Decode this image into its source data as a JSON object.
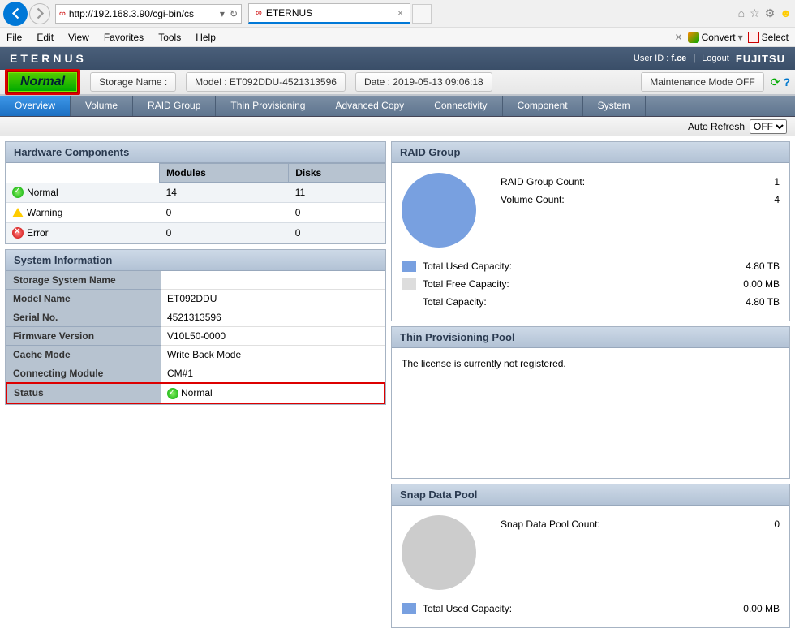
{
  "browser": {
    "url": "http://192.168.3.90/cgi-bin/cs",
    "tab_title": "ETERNUS",
    "menu": [
      "File",
      "Edit",
      "View",
      "Favorites",
      "Tools",
      "Help"
    ],
    "convert_label": "Convert",
    "select_label": "Select"
  },
  "header": {
    "brand": "ETERNUS",
    "user_label": "User ID :",
    "user_id": "f.ce",
    "logout": "Logout",
    "vendor": "FUJITSU"
  },
  "status_bar": {
    "status": "Normal",
    "storage_name_label": "Storage Name :",
    "model_label": "Model : ET092DDU-4521313596",
    "date_label": "Date : 2019-05-13 09:06:18",
    "maintenance": "Maintenance Mode OFF"
  },
  "nav": [
    "Overview",
    "Volume",
    "RAID Group",
    "Thin Provisioning",
    "Advanced Copy",
    "Connectivity",
    "Component",
    "System"
  ],
  "auto_refresh_label": "Auto Refresh",
  "auto_refresh_value": "OFF",
  "hw_panel": {
    "title": "Hardware Components",
    "cols": [
      "",
      "Modules",
      "Disks"
    ],
    "rows": [
      {
        "status": "Normal",
        "icon": "ok",
        "modules": "14",
        "disks": "11"
      },
      {
        "status": "Warning",
        "icon": "warn",
        "modules": "0",
        "disks": "0"
      },
      {
        "status": "Error",
        "icon": "err",
        "modules": "0",
        "disks": "0"
      }
    ]
  },
  "sys_panel": {
    "title": "System Information",
    "rows": [
      {
        "k": "Storage System Name",
        "v": ""
      },
      {
        "k": "Model Name",
        "v": "ET092DDU"
      },
      {
        "k": "Serial No.",
        "v": "4521313596"
      },
      {
        "k": "Firmware Version",
        "v": "V10L50-0000"
      },
      {
        "k": "Cache Mode",
        "v": "Write Back Mode"
      },
      {
        "k": "Connecting Module",
        "v": "CM#1"
      },
      {
        "k": "Status",
        "v": "Normal",
        "highlight": true,
        "icon": "ok"
      }
    ]
  },
  "raid_panel": {
    "title": "RAID Group",
    "count_label": "RAID Group Count:",
    "count": "1",
    "vol_label": "Volume Count:",
    "vol": "4",
    "legend": [
      {
        "swatch": "blue",
        "label": "Total Used Capacity:",
        "val": "4.80 TB"
      },
      {
        "swatch": "gray",
        "label": "Total Free Capacity:",
        "val": "0.00 MB"
      },
      {
        "swatch": "empty",
        "label": "Total Capacity:",
        "val": "4.80 TB"
      }
    ]
  },
  "thin_panel": {
    "title": "Thin Provisioning Pool",
    "msg": "The license is currently not registered."
  },
  "snap_panel": {
    "title": "Snap Data Pool",
    "count_label": "Snap Data Pool Count:",
    "count": "0",
    "legend": [
      {
        "swatch": "blue",
        "label": "Total Used Capacity:",
        "val": "0.00 MB"
      }
    ]
  },
  "chart_data": [
    {
      "type": "pie",
      "title": "RAID Group",
      "series": [
        {
          "name": "Used",
          "value": 4.8,
          "unit": "TB"
        },
        {
          "name": "Free",
          "value": 0.0,
          "unit": "MB"
        }
      ]
    },
    {
      "type": "pie",
      "title": "Snap Data Pool",
      "series": [
        {
          "name": "Used",
          "value": 0.0,
          "unit": "MB"
        }
      ]
    }
  ]
}
